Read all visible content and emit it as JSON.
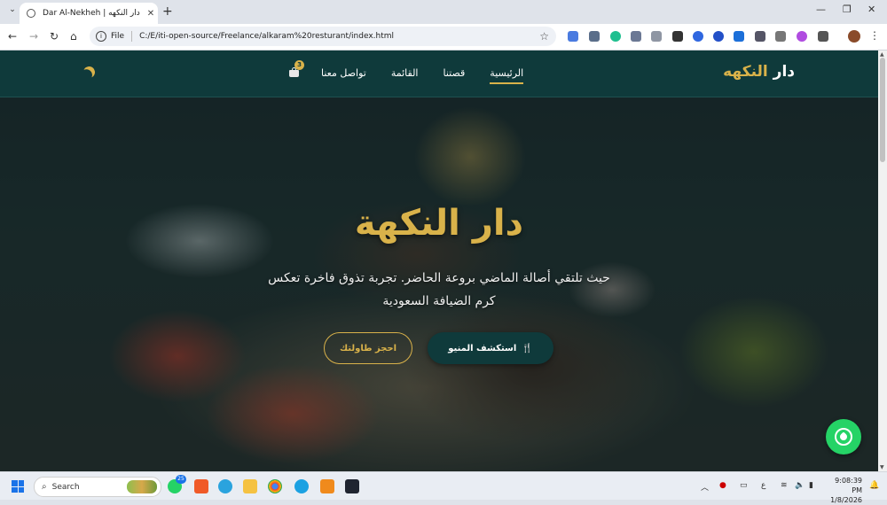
{
  "browser": {
    "tab_title": "Dar Al-Nekheh | دار النكهه",
    "address_protocol": "File",
    "address_url": "C:/E/iti-open-source/Freelance/alkaram%20resturant/index.html"
  },
  "site": {
    "logo_main": "دار ",
    "logo_accent": "النكهه",
    "nav": [
      {
        "label": "الرئيسية",
        "active": true
      },
      {
        "label": "قصتنا",
        "active": false
      },
      {
        "label": "القائمة",
        "active": false
      },
      {
        "label": "تواصل معنا",
        "active": false
      }
    ],
    "cart_count": "3",
    "accent_color": "#d9b24a",
    "primary_color": "#0f3a3b"
  },
  "hero": {
    "title": "دار النكهة",
    "subtitle": "حيث تلتقي أصالة الماضي بروعة الحاضر. تجربة تذوق فاخرة تعكس كرم الضيافة السعودية",
    "btn_menu": "استكشف المنيو",
    "btn_menu_icon": "utensils-icon",
    "btn_reserve": "احجز طاولتك"
  },
  "taskbar": {
    "search_placeholder": "Search",
    "badge_count": "25",
    "lang": "ع",
    "time": "9:08:39 PM",
    "date": "1/8/2026"
  }
}
